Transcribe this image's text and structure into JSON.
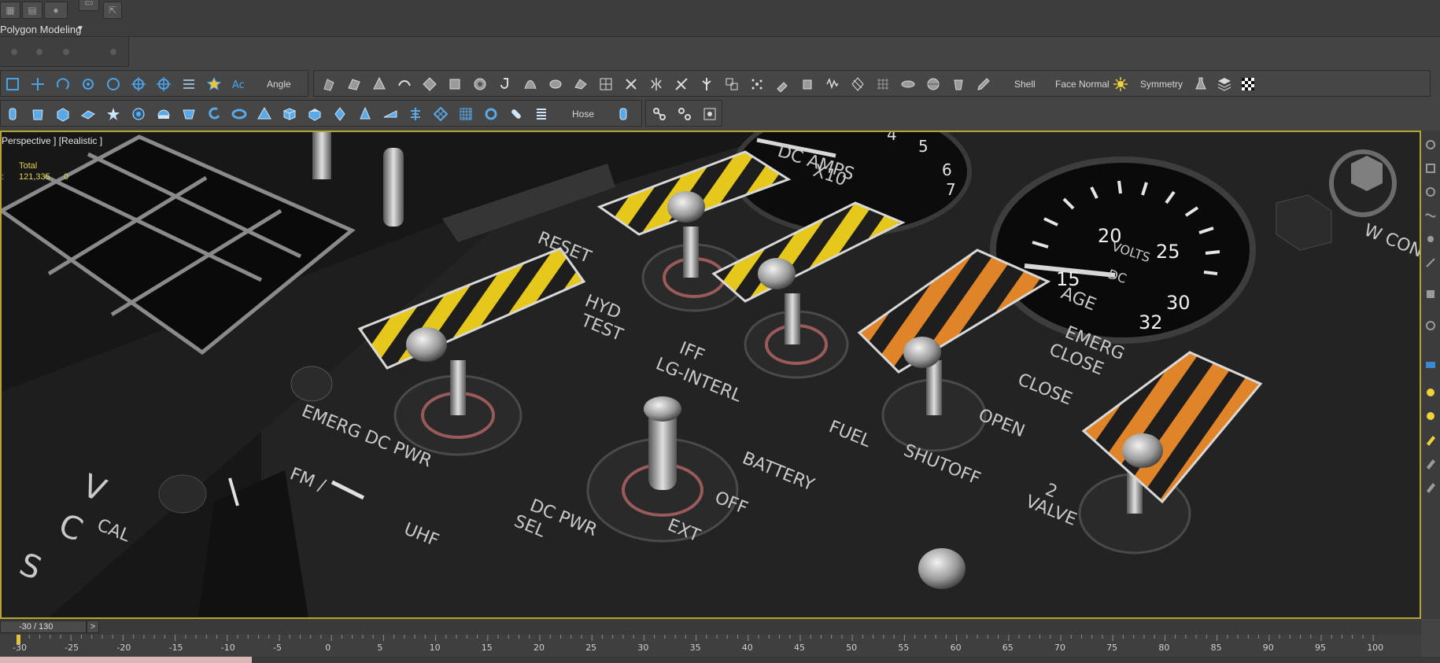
{
  "workspace": {
    "ribbon_label": "Polygon Modeling"
  },
  "toolbar1": {
    "angle_label": "Angle",
    "shell_label": "Shell",
    "face_normal_label": "Face Normal",
    "symmetry_label": "Symmetry"
  },
  "toolbar2": {
    "hose_label": "Hose"
  },
  "viewport": {
    "label": "Perspective ] [Realistic ]",
    "stats": {
      "title": "Total",
      "colon": ":",
      "value": "121,335",
      "extra": "0"
    },
    "panel_labels": {
      "reset": "RESET",
      "hyd": "HYD",
      "test": "TEST",
      "iff": "IFF",
      "lg_interl": "LG-INTERL",
      "emerg_dc_pwr": "EMERG DC PWR",
      "fm": "FM /",
      "uhf": "UHF",
      "dc_pwr": "DC PWR",
      "sel": "SEL",
      "battery": "BATTERY",
      "off": "OFF",
      "ext": "EXT",
      "fuel": "FUEL",
      "shutoff": "SHUTOFF",
      "valve": "VALVE",
      "valve_num": "2",
      "open": "OPEN",
      "close": "CLOSE",
      "emerg": "EMERG",
      "close2": "CLOSE",
      "age": "AGE",
      "dc_amps": "DC AMPS",
      "x10": "X10",
      "volts": "VOLTS",
      "dc": "DC",
      "v_letter": "V",
      "c_letter": "C",
      "s_letter": "S",
      "cal": "CAL",
      "w_cont": "W CONT",
      "dc_amps_ticks": [
        "4",
        "5",
        "6",
        "7"
      ],
      "volts_ticks": [
        "15",
        "20",
        "25",
        "30",
        "32"
      ]
    }
  },
  "timeline": {
    "frame_display": "-30 / 130",
    "next_btn": ">",
    "ticks": [
      "-30",
      "-25",
      "-20",
      "-15",
      "-10",
      "-5",
      "0",
      "5",
      "10",
      "15",
      "20",
      "25",
      "30",
      "35",
      "40",
      "45",
      "50",
      "55",
      "60",
      "65",
      "70",
      "75",
      "80",
      "85",
      "90",
      "95",
      "100"
    ]
  }
}
